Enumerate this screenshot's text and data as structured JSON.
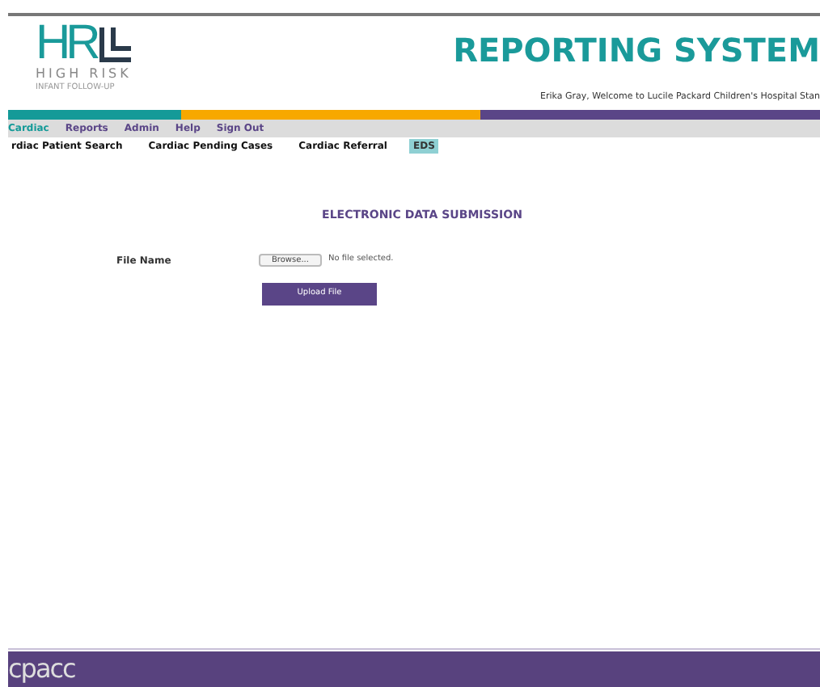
{
  "logo": {
    "letters": "HR",
    "line_1": "HIGH RISK",
    "line_2": "INFANT FOLLOW-UP"
  },
  "title": "REPORTING SYSTEM",
  "welcome": "Erika Gray, Welcome to Lucile Packard Children's Hospital Stan",
  "menu": [
    {
      "label": "Cardiac",
      "selected": true
    },
    {
      "label": "Reports",
      "selected": false
    },
    {
      "label": "Admin",
      "selected": false
    },
    {
      "label": "Help",
      "selected": false
    },
    {
      "label": "Sign Out",
      "selected": false
    }
  ],
  "submenu": [
    {
      "label": "rdiac Patient Search",
      "selected": false
    },
    {
      "label": "Cardiac Pending Cases",
      "selected": false
    },
    {
      "label": "Cardiac Referral",
      "selected": false
    },
    {
      "label": "EDS",
      "selected": true
    }
  ],
  "heading": "ELECTRONIC DATA SUBMISSION",
  "form": {
    "label": "File Name",
    "browse": "Browse...",
    "status": "No file selected.",
    "submit": "Upload File"
  },
  "footer": {
    "logo": "cpacc"
  }
}
